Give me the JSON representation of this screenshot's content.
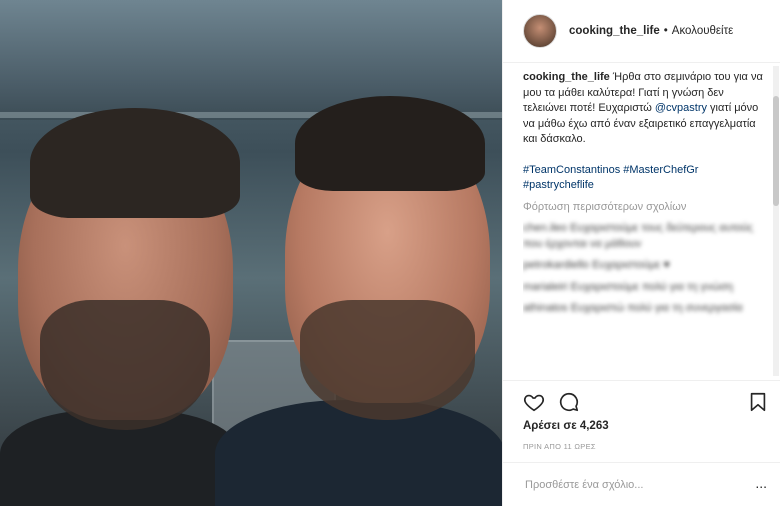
{
  "header": {
    "username": "cooking_the_life",
    "separator": "•",
    "follow_label": "Ακολουθείτε"
  },
  "caption": {
    "username": "cooking_the_life",
    "text_before_mention": " Ήρθα στο σεμινάριο του για να μου τα μάθει καλύτερα! Γιατί η γνώση δεν τελειώνει ποτέ! Ευχαριστώ ",
    "mention": "@cvpastry",
    "text_after_mention": " γιατί μόνο να μάθω έχω από έναν εξαιρετικό επαγγελματία και δάσκαλο.",
    "hashtags": "#TeamConstantinos #MasterChefGr #pastrycheflife"
  },
  "load_more_label": "Φόρτωση περισσότερων σχολίων",
  "blurred_comments": [
    "chen.ileo Ευχαριστούμε τους δεύτερους αυτούς που έρχονται να μάθουν",
    "petrokardiello Ευχαριστούμε ♥",
    "marialeiri Ευχαριστούμε πολύ για τη γνώση",
    "athinatos Ευχαριστώ πολύ για τη συνεργασία"
  ],
  "likes_text": "Αρέσει σε 4,263",
  "timestamp": "ΠΡΙΝ ΑΠΟ 11 ΩΡΕΣ",
  "comment_input": {
    "placeholder": "Προσθέστε ένα σχόλιο..."
  },
  "more_options_label": "..."
}
